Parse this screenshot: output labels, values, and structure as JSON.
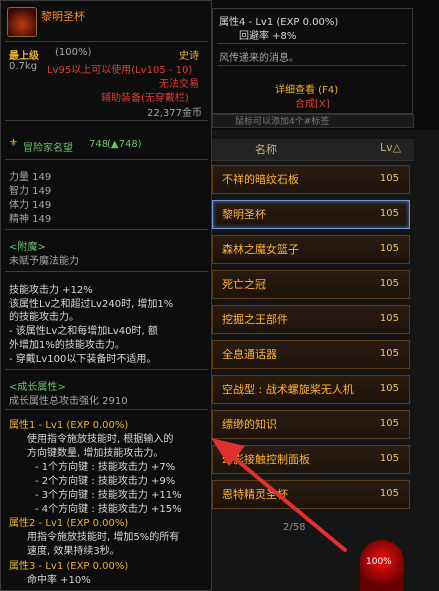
{
  "item": {
    "name": "黎明圣杯",
    "grade_label": "最上级",
    "grade_pct": "(100%)",
    "rarity": "史诗",
    "weight": "0.7kg",
    "level_req": "Lv95以上可以使用(Lv105 - 10)",
    "trade": "无法交易",
    "type": "辅助装备(无穿戴栏)",
    "price": "22,377金币",
    "fame_label": "冒险家名望",
    "fame_value": "748",
    "fame_up": "(▲748)",
    "stats": [
      "力量 149",
      "智力 149",
      "体力 149",
      "精神 149"
    ],
    "enchant_title": "<附魔>",
    "enchant_value": "未赋予魔法能力",
    "skill_lines": [
      "技能攻击力 +12%",
      "该属性Lv之和超过Lv240时, 增加1%",
      "的技能攻击力。",
      "- 该属性Lv之和每增加Lv40时, 额",
      "外增加1%的技能攻击力。",
      "- 穿戴Lv100以下装备时不适用。"
    ],
    "growth_title": "<成长属性>",
    "growth_total": "成长属性总攻击强化 2910",
    "attr1_title": "属性1 - Lv1 (EXP 0.00%)",
    "attr1_lines": [
      "使用指令施放技能时, 根据输入的",
      "方向键数量, 增加技能攻击力。",
      "- 1个方向键 : 技能攻击力 +7%",
      "- 2个方向键 : 技能攻击力 +9%",
      "- 3个方向键 : 技能攻击力 +11%",
      "- 4个方向键 : 技能攻击力 +15%"
    ],
    "attr2_title": "属性2 - Lv1 (EXP 0.00%)",
    "attr2_lines": [
      "用指令施放技能时, 增加5%的所有",
      "速度, 效果持续3秒。"
    ],
    "attr3_title": "属性3 - Lv1 (EXP 0.00%)",
    "attr3_lines": [
      "命中率 +10%"
    ]
  },
  "tooltip_top": {
    "attr4_title": "属性4 - Lv1 (EXP 0.00%)",
    "attr4_value": "回避率 +8%",
    "flavor": "风传递来的消息。",
    "detail_link": "详细查看 (F4)",
    "compose": "合成[X]"
  },
  "list": {
    "search_text": "鼠标可以添加4个#标签",
    "header_name": "名称",
    "header_lv": "Lv△",
    "rows": [
      {
        "name": "不祥的暗纹石板",
        "lv": "105"
      },
      {
        "name": "黎明圣杯",
        "lv": "105"
      },
      {
        "name": "森林之魔女篮子",
        "lv": "105"
      },
      {
        "name": "死亡之冠",
        "lv": "105"
      },
      {
        "name": "挖掘之王部件",
        "lv": "105"
      },
      {
        "name": "全息通话器",
        "lv": "105"
      },
      {
        "name": "空战型 : 战术螺旋桨无人机",
        "lv": "105"
      },
      {
        "name": "缥缈的知识",
        "lv": "105"
      },
      {
        "name": "幻影接触控制面板",
        "lv": "105"
      },
      {
        "name": "恩特精灵圣杯",
        "lv": "105"
      }
    ],
    "pager": "2/58"
  },
  "hud": {
    "hp_pct": "100%"
  },
  "colors": {
    "epic": "#f0b030",
    "item_name": "#ffb23a",
    "warning": "#e03b3b",
    "growth": "#6ac36a",
    "arrow": "#e03030"
  }
}
